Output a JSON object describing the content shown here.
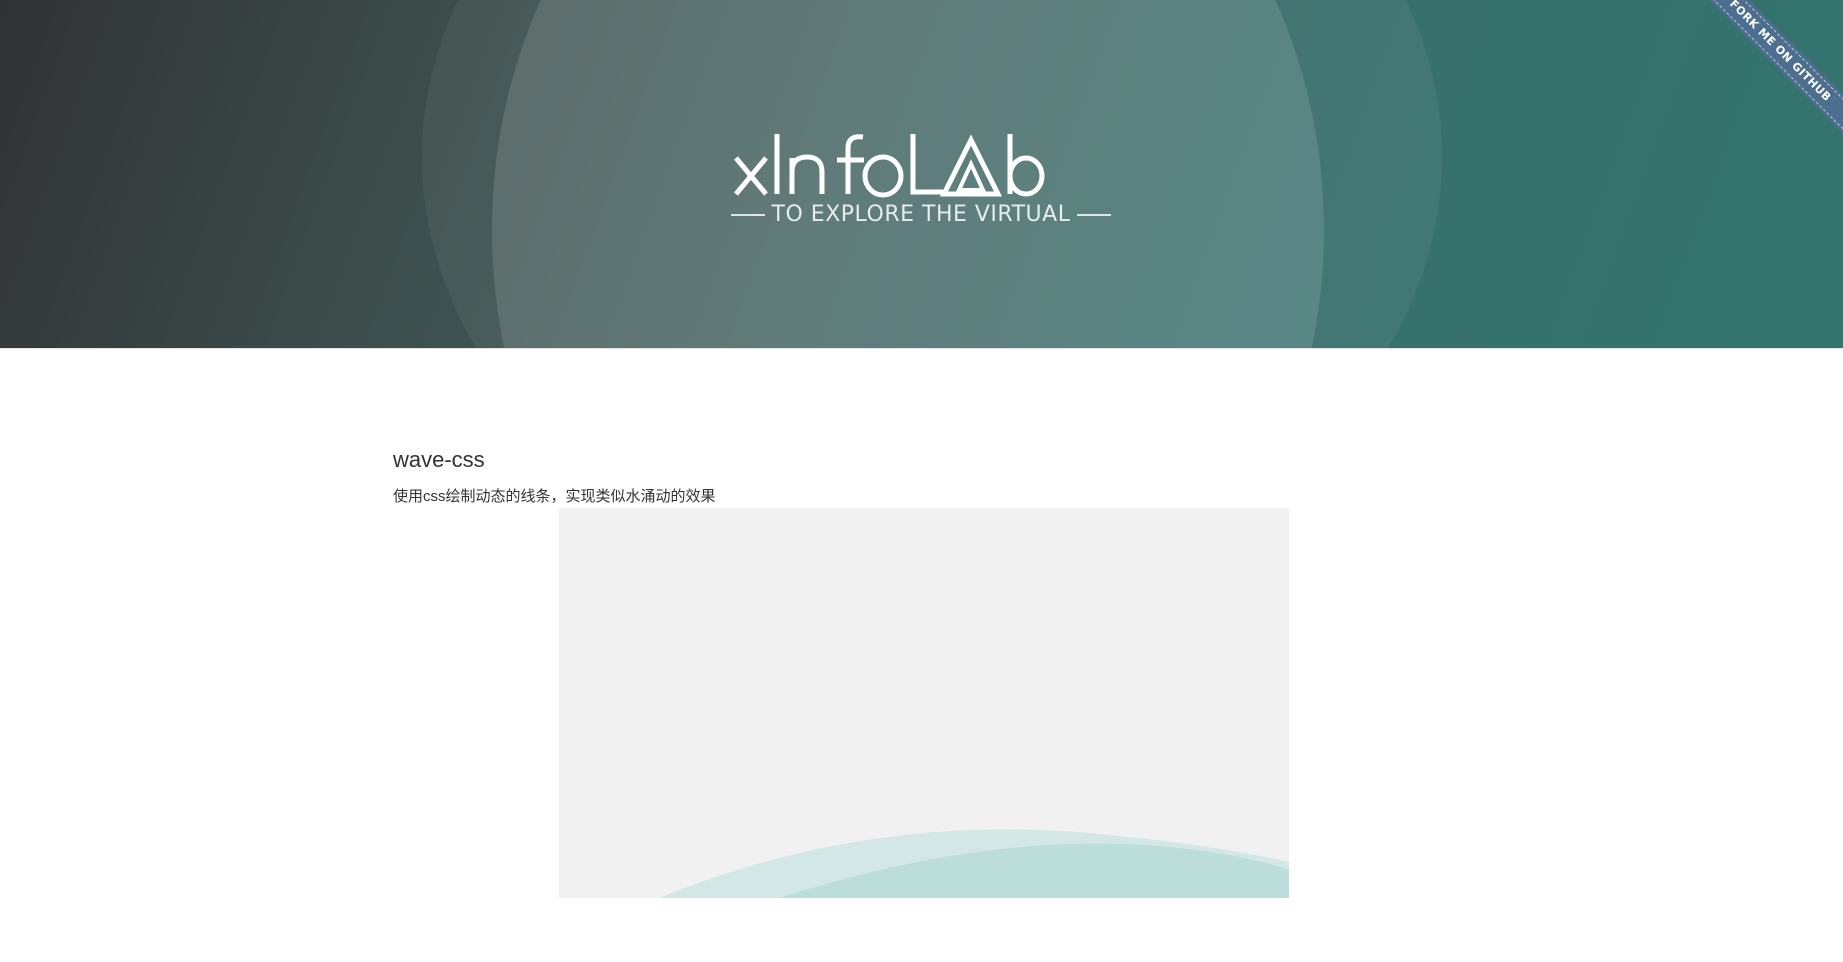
{
  "header": {
    "logo_text": "xInfoLab",
    "tagline": "TO EXPLORE THE VIRTUAL"
  },
  "ribbon": {
    "label": "FORK ME ON GITHUB"
  },
  "content": {
    "title": "wave-css",
    "description": "使用css绘制动态的线条，实现类似水涌动的效果"
  },
  "colors": {
    "hero_gradient_start": "#313233",
    "hero_gradient_end": "#33746f",
    "ribbon": "#4d6f8f",
    "demo_background": "#f1f1f1",
    "wave": "#a8d5d1"
  }
}
